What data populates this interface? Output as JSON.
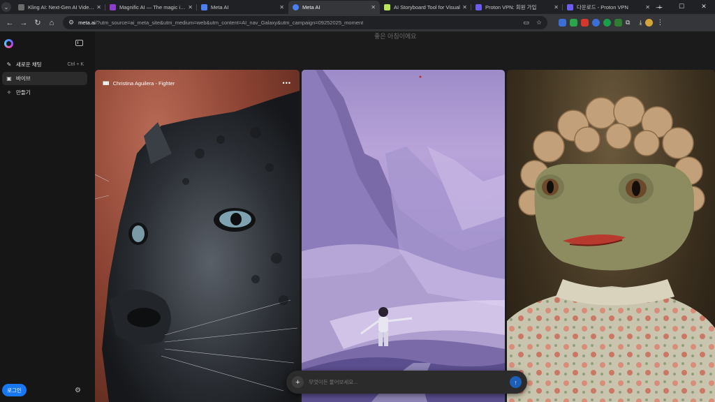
{
  "browser": {
    "tabs": [
      {
        "title": "Kling AI: Next-Gen AI Video &",
        "favicon_color": "#6b6b6b",
        "active": false
      },
      {
        "title": "Magnific AI — The magic imag",
        "favicon_color": "#8a3ec9",
        "active": false
      },
      {
        "title": "Meta AI",
        "favicon_color": "#4c7ff2",
        "active": false
      },
      {
        "title": "Meta AI",
        "favicon_color": "#4c7ff2",
        "active": true
      },
      {
        "title": "AI Storyboard Tool for Visual",
        "favicon_color": "#b8e35a",
        "active": false
      },
      {
        "title": "Proton VPN: 회원 가입",
        "favicon_color": "#6d5cf2",
        "active": false
      },
      {
        "title": "다운로드 - Proton VPN",
        "favicon_color": "#6d5cf2",
        "active": false
      }
    ],
    "new_tab_glyph": "+",
    "url_host": "meta.ai",
    "url_rest": "/?utm_source=ai_meta_site&utm_medium=web&utm_content=AI_nav_Galaxy&utm_campaign=09252025_moment",
    "extension_colors": [
      "#3a6fd8",
      "#2aa54a",
      "#d6372b",
      "#3a6fd8",
      "#1a9e4b",
      "#2e7d32"
    ]
  },
  "sidebar": {
    "items": [
      {
        "icon": "new-chat-icon",
        "label": "새로운 채팅",
        "shortcut": "Ctrl + K",
        "active": false
      },
      {
        "icon": "vibes-icon",
        "label": "바이브",
        "shortcut": "",
        "active": true
      },
      {
        "icon": "create-icon",
        "label": "만들기",
        "shortcut": "",
        "active": false
      }
    ],
    "login_label": "로그인"
  },
  "main": {
    "greeting": "좋은 아침이에요",
    "feed": [
      {
        "caption": "Christina Aguilera - Fighter",
        "subject": "black panther portrait"
      },
      {
        "caption": "",
        "subject": "pastel mountain valley with child"
      },
      {
        "caption": "",
        "subject": "frog in curly wig and floral blouse"
      }
    ],
    "composer": {
      "placeholder": "무엇이든 물어보세요..."
    }
  },
  "colors": {
    "accent": "#1877f2",
    "background": "#1b1b1b",
    "sidebar": "#161616"
  }
}
